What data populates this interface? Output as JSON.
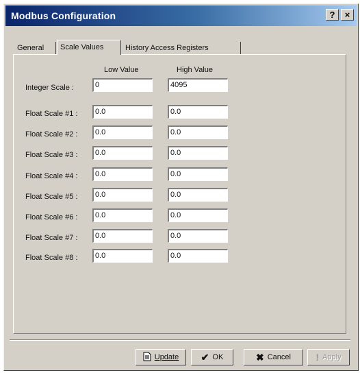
{
  "window": {
    "title": "Modbus Configuration",
    "help_glyph": "?",
    "close_glyph": "×"
  },
  "tabs": [
    {
      "label": "General",
      "active": false
    },
    {
      "label": "Scale Values",
      "active": true
    },
    {
      "label": "History Access Registers",
      "active": false
    }
  ],
  "columns": {
    "low": "Low Value",
    "high": "High Value"
  },
  "integer_scale": {
    "label": "Integer Scale :",
    "low": "0",
    "high": "4095"
  },
  "float_scales": [
    {
      "label": "Float Scale #1 :",
      "low": "0.0",
      "high": "0.0"
    },
    {
      "label": "Float Scale #2 :",
      "low": "0.0",
      "high": "0.0"
    },
    {
      "label": "Float Scale #3 :",
      "low": "0.0",
      "high": "0.0"
    },
    {
      "label": "Float Scale #4 :",
      "low": "0.0",
      "high": "0.0"
    },
    {
      "label": "Float Scale #5 :",
      "low": "0.0",
      "high": "0.0"
    },
    {
      "label": "Float Scale #6 :",
      "low": "0.0",
      "high": "0.0"
    },
    {
      "label": "Float Scale #7 :",
      "low": "0.0",
      "high": "0.0"
    },
    {
      "label": "Float Scale #8 :",
      "low": "0.0",
      "high": "0.0"
    }
  ],
  "buttons": {
    "update": "Update",
    "ok": "OK",
    "cancel": "Cancel",
    "apply": "Apply"
  },
  "icons": {
    "update": "document-icon",
    "ok": "checkmark-icon",
    "cancel": "x-icon",
    "apply": "exclamation-icon"
  },
  "colors": {
    "titlebar_start": "#0a246a",
    "titlebar_end": "#a6caf0",
    "face": "#d4d0c8"
  }
}
